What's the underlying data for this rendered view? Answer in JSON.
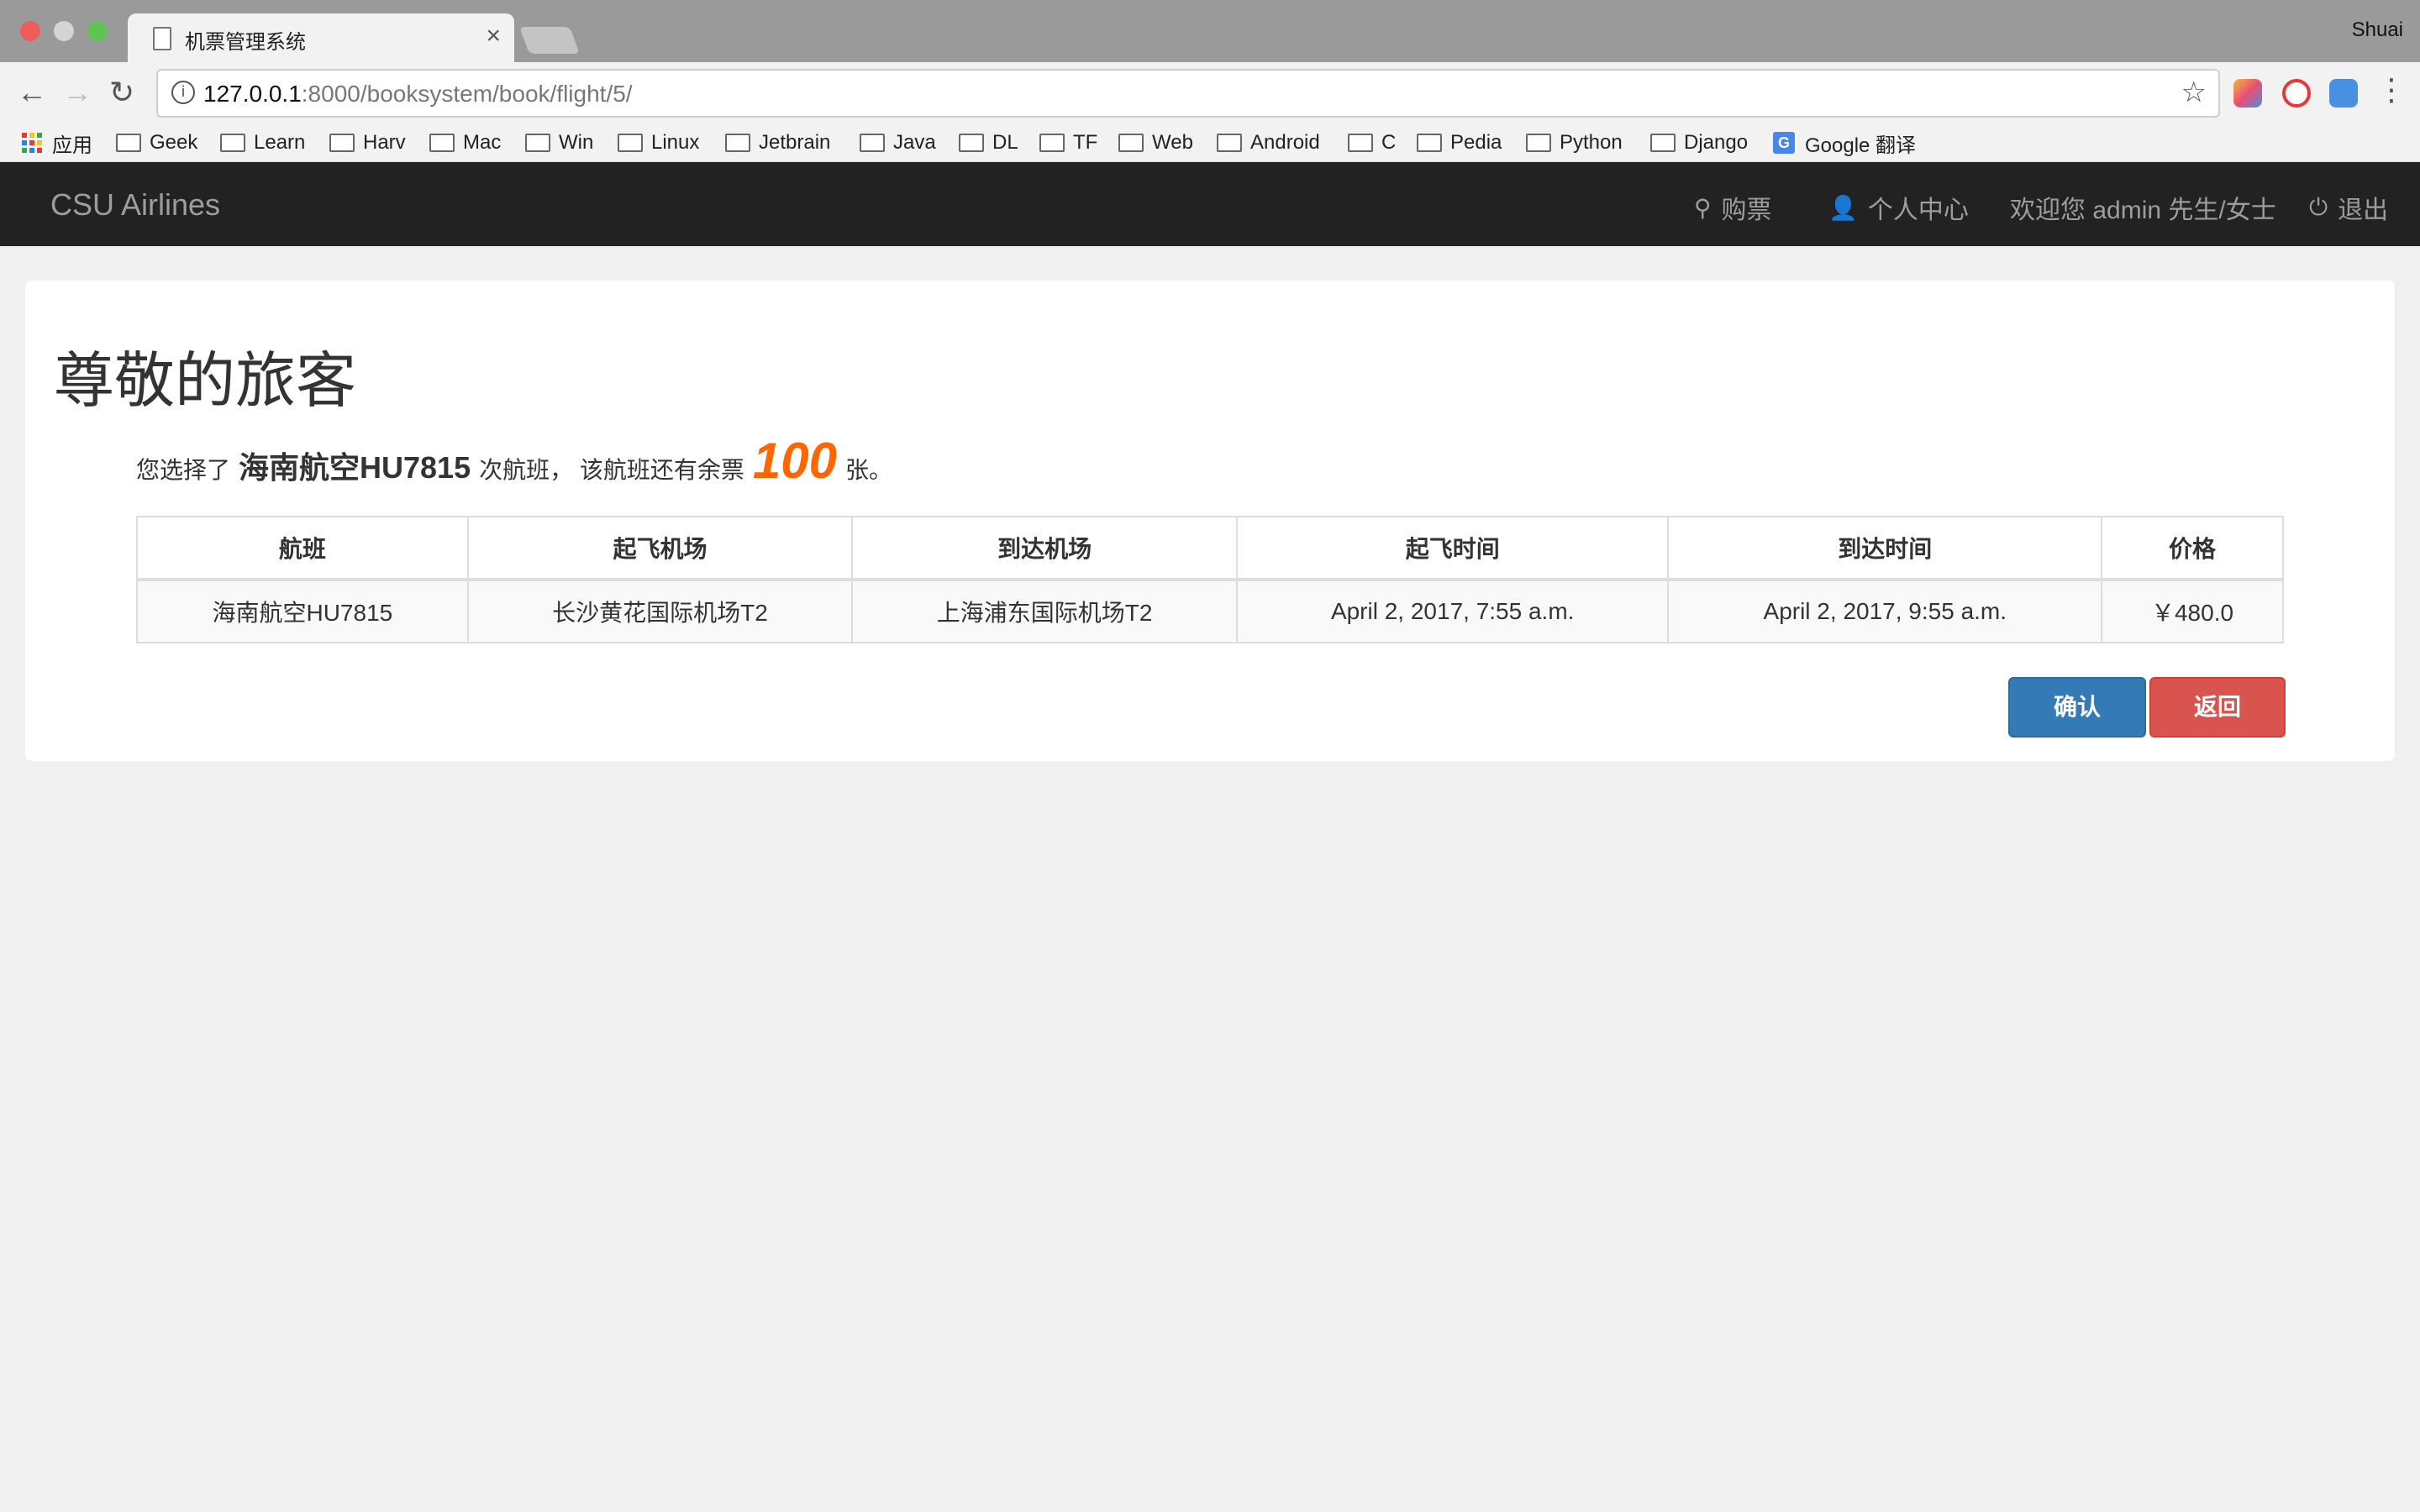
{
  "browser": {
    "tab_title": "机票管理系统",
    "tab_close": "×",
    "user": "Shuai",
    "url_host": "127.0.0.1",
    "url_rest": ":8000/booksystem/book/flight/5/",
    "bookmarks": [
      "应用",
      "Geek",
      "Learn",
      "Harv",
      "Mac",
      "Win",
      "Linux",
      "Jetbrain",
      "Java",
      "DL",
      "TF",
      "Web",
      "Android",
      "C",
      "Pedia",
      "Python",
      "Django",
      "Google 翻译"
    ]
  },
  "navbar": {
    "brand": "CSU Airlines",
    "search": "购票",
    "profile": "个人中心",
    "welcome": "欢迎您 admin 先生/女士",
    "logout": "退出"
  },
  "main": {
    "heading": "尊敬的旅客",
    "summary_prefix": "您选择了",
    "flight_name": "海南航空HU7815",
    "summary_mid": "次航班，  该航班还有余票",
    "ticket_count": "100",
    "summary_suffix": "张。",
    "table": {
      "headers": [
        "航班",
        "起飞机场",
        "到达机场",
        "起飞时间",
        "到达时间",
        "价格"
      ],
      "row": [
        "海南航空HU7815",
        "长沙黄花国际机场T2",
        "上海浦东国际机场T2",
        "April 2, 2017, 7:55 a.m.",
        "April 2, 2017, 9:55 a.m.",
        "￥480.0"
      ]
    },
    "confirm_label": "确认",
    "back_label": "返回"
  },
  "colors": {
    "navbar_bg": "#222222",
    "accent_count": "#ff6600",
    "confirm_btn": "#337ab7",
    "back_btn": "#d9534f"
  }
}
